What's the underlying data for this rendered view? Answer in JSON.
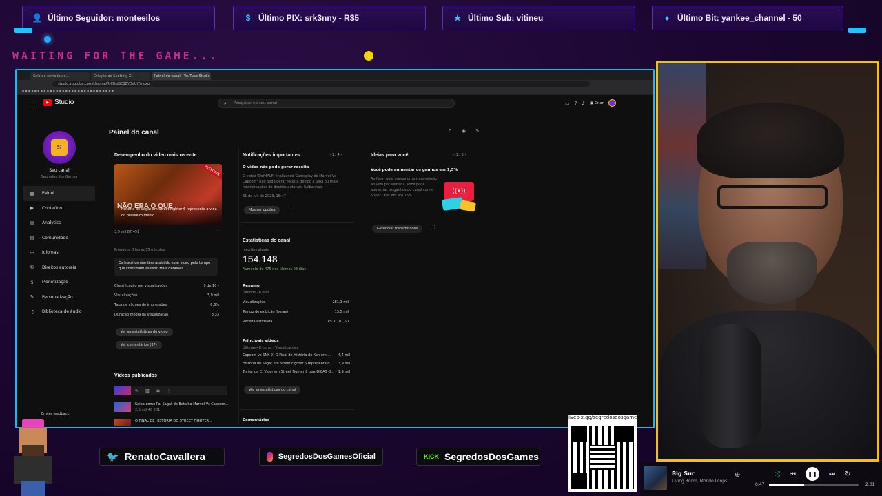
{
  "alerts": {
    "follower": "Último Seguidor: monteeilos",
    "pix": "Último PIX: srk3nny - R$5",
    "sub": "Último Sub: vitineu",
    "bit": "Último Bit: yankee_channel - 50"
  },
  "waiting_text": "WAITING FOR THE GAME...",
  "browser": {
    "tabs": [
      "Sala de entrada de...",
      "Criação do Spotting Z...",
      "Painel do canal - YouTube Studio"
    ],
    "url": "studio.youtube.com/channel/UCJhdSEB8YDdUi7moxg"
  },
  "studio": {
    "logo": "Studio",
    "search_placeholder": "Pesquisar no seu canal",
    "create_label": "Criar",
    "page_title": "Painel do canal",
    "channel_name": "Seu canal",
    "channel_sub": "Segredos dos Games",
    "nav": [
      {
        "label": "Painel",
        "icon": "▦"
      },
      {
        "label": "Conteúdo",
        "icon": "▶"
      },
      {
        "label": "Analytics",
        "icon": "▥"
      },
      {
        "label": "Comunidade",
        "icon": "▤"
      },
      {
        "label": "Idiomas",
        "icon": "▭"
      },
      {
        "label": "Direitos autorais",
        "icon": "©"
      },
      {
        "label": "Monetização",
        "icon": "$"
      },
      {
        "label": "Personalização",
        "icon": "✎"
      },
      {
        "label": "Biblioteca de áudio",
        "icon": "♫"
      }
    ],
    "feedback": "Enviar feedback"
  },
  "latest_video": {
    "heading": "Desempenho do vídeo mais recente",
    "thumb_big": "NÃO ERA O QUE",
    "thumb_caption": "História de Sagat em Street Fighter 6 representa a vida do brasileiro médio",
    "thumb_ribbon": "HISTÓRIA",
    "stats_line": "3,9 mil   87   451",
    "period": "Primeiros 8 horas 55 minutos",
    "insight": "Os inscritos não têm assistido esse vídeo pelo tempo que costumam assistir. Mais detalhes",
    "rows": [
      {
        "label": "Classificação por visualizações",
        "value": "9 de 10 ›"
      },
      {
        "label": "Visualizações",
        "value": "3,9 mil"
      },
      {
        "label": "Taxa de cliques de impressões",
        "value": "6,6%"
      },
      {
        "label": "Duração média da visualização",
        "value": "3:33"
      }
    ],
    "btn_stats": "Ver as estatísticas do vídeo",
    "btn_comments": "Ver comentários (37)",
    "published_heading": "Vídeos publicados",
    "published_item": "Saiba como Pai Sagat de Batalha Marvel Vs Capcom...",
    "published_meta": "2,5 mil   48   281",
    "published_item2": "O FINAL DE HISTÓRIA DO STREET FIGHTER..."
  },
  "notifications": {
    "heading": "Notificações importantes",
    "pager": "1 / 4",
    "title": "O vídeo não pode gerar receita",
    "body": "O vídeo \"DefHALF: finalizando Gameplay de Marvel Vs Capcom\" não pode gerar receita devido a uma ou mais reivindicações de direitos autorais. Saiba mais",
    "date": "31 de jul. de 2023, 15:47",
    "btn": "Mostrar opções"
  },
  "channel_stats": {
    "heading": "Estatísticas do canal",
    "subs_label": "Inscritos atuais",
    "subs_value": "154.148",
    "subs_delta": "Aumento de 475 nos últimos 28 dias",
    "summary_heading": "Resumo",
    "summary_period": "Últimos 28 dias",
    "summary_rows": [
      {
        "label": "Visualizações",
        "value": "281,1 mil"
      },
      {
        "label": "Tempo de exibição (horas)",
        "value": "13,5 mil"
      },
      {
        "label": "Receita estimada",
        "value": "R$ 1.101,60"
      }
    ],
    "top_heading": "Principais vídeos",
    "top_period": "Últimas 48 horas · Visualizações",
    "top_rows": [
      {
        "label": "Capcom vs SNK 2! O Final de História de Ken em ...",
        "value": "4,4 mil"
      },
      {
        "label": "História do Sagat em Street Fighter 6 representa o ...",
        "value": "3,9 mil"
      },
      {
        "label": "Trailer da C. Viper em Street Fighter 6 traz DICAS O...",
        "value": "1,9 mil"
      }
    ],
    "btn": "Ver as estatísticas do canal",
    "comments_heading": "Comentários"
  },
  "ideas": {
    "heading": "Ideias para você",
    "pager": "1 / 3",
    "title": "Você pode aumentar os ganhos em 1,5%",
    "body": "Ao fazer pelo menos uma transmissão ao vivo por semana, você pode aumentar os ganhos do canal com o Super Chat em até 15%",
    "btn": "Gerenciar transmissões"
  },
  "socials": {
    "twitter": "RenatoCavallera",
    "instagram": "SegredosDosGamesOficial",
    "kick_label": "KICK",
    "kick": "SegredosDosGames"
  },
  "qr_label": "livepix.gg/segredosdosgames",
  "player": {
    "title": "Big Sur",
    "subtitle": "Living Room, Mondo Loops",
    "elapsed": "0:47",
    "duration": "2:01",
    "progress": 0.39
  },
  "colors": {
    "accent_cyan": "#1fb8ee",
    "cam_border": "#f3c20b",
    "yt_red": "#ff0000"
  }
}
